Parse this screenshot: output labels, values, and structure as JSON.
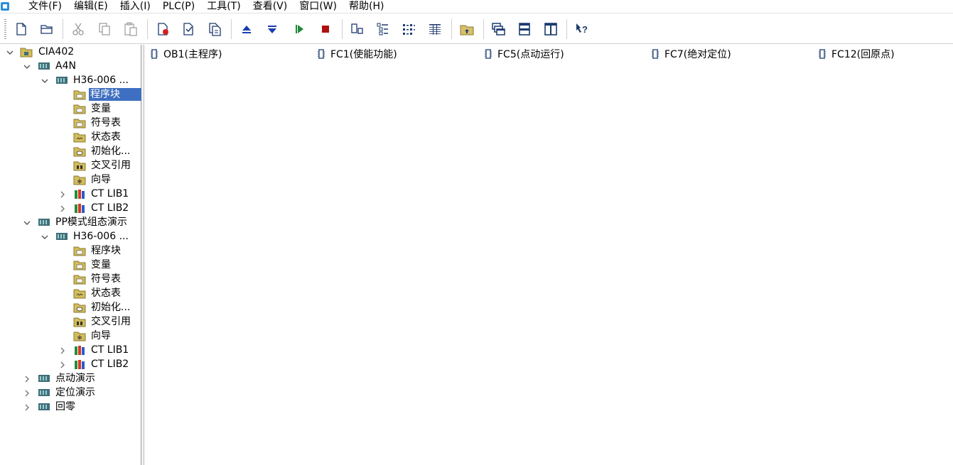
{
  "menu": {
    "items": [
      "文件(F)",
      "编辑(E)",
      "插入(I)",
      "PLC(P)",
      "工具(T)",
      "查看(V)",
      "窗口(W)",
      "帮助(H)"
    ]
  },
  "toolbar": {
    "buttons": [
      {
        "name": "new-icon"
      },
      {
        "name": "open-icon"
      },
      {
        "name": "cut-icon"
      },
      {
        "name": "copy-icon"
      },
      {
        "name": "paste-icon"
      },
      {
        "name": "delete-doc-icon"
      },
      {
        "name": "check-doc-icon"
      },
      {
        "name": "compare-doc-icon"
      },
      {
        "name": "upload-icon"
      },
      {
        "name": "download-icon"
      },
      {
        "name": "run-icon"
      },
      {
        "name": "stop-icon"
      },
      {
        "name": "large-icons-view-icon"
      },
      {
        "name": "small-icons-view-icon"
      },
      {
        "name": "list-view-icon"
      },
      {
        "name": "details-view-icon"
      },
      {
        "name": "up-folder-icon"
      },
      {
        "name": "cascade-windows-icon"
      },
      {
        "name": "tile-horizontal-icon"
      },
      {
        "name": "tile-vertical-icon"
      },
      {
        "name": "context-help-icon"
      }
    ]
  },
  "tree": {
    "root": "CIA402",
    "a4n": "A4N",
    "a4n_cpu": "H36-006 ...",
    "a4n_children": [
      "程序块",
      "变量",
      "符号表",
      "状态表",
      "初始化...",
      "交叉引用",
      "向导",
      "CT LIB1",
      "CT LIB2"
    ],
    "pp": "PP模式组态演示",
    "pp_cpu": "H36-006 ...",
    "pp_children": [
      "程序块",
      "变量",
      "符号表",
      "状态表",
      "初始化...",
      "交叉引用",
      "向导",
      "CT LIB1",
      "CT LIB2"
    ],
    "others": [
      "点动演示",
      "定位演示",
      "回零"
    ]
  },
  "content": {
    "blocks": [
      "OB1(主程序)",
      "FC1(使能功能)",
      "FC5(点动运行)",
      "FC7(绝对定位)",
      "FC12(回原点)"
    ]
  },
  "colors": {
    "selection": "#3e6fc0",
    "folder": "#c8b25a",
    "plc": "#3f6f7a"
  }
}
